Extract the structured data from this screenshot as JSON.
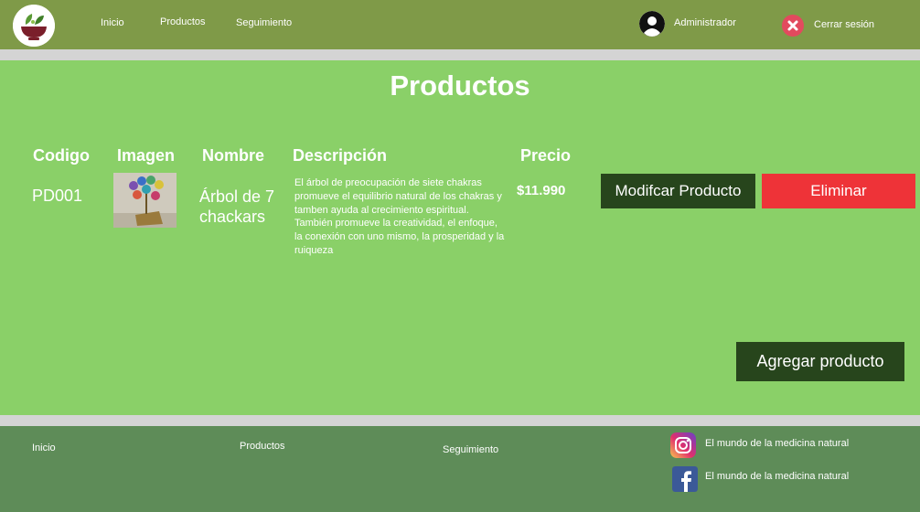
{
  "header": {
    "nav": [
      {
        "label": "Inicio"
      },
      {
        "label": "Productos"
      },
      {
        "label": "Seguimiento"
      }
    ],
    "user_label": "Administrador",
    "logout_label": "Cerrar sesión"
  },
  "main": {
    "title": "Productos",
    "columns": [
      "Codigo",
      "Imagen",
      "Nombre",
      "Descripción",
      "Precio"
    ],
    "rows": [
      {
        "code": "PD001",
        "name": "Árbol de 7 chackars",
        "description": "El árbol de preocupación de siete chakras promueve el equilibrio natural de los chakras y tamben ayuda al crecimiento espiritual.\nTambién promueve la creatividad, el enfoque, la conexión con uno mismo, la prosperidad y la ruiqueza",
        "price": "$11.990",
        "edit_label": "Modifcar Producto",
        "delete_label": "Eliminar"
      }
    ],
    "add_label": "Agregar producto"
  },
  "footer": {
    "links": [
      {
        "label": "Inicio"
      },
      {
        "label": "Productos"
      },
      {
        "label": "Seguimiento"
      }
    ],
    "social": [
      {
        "icon": "instagram-icon",
        "label": "El mundo de la medicina natural"
      },
      {
        "icon": "facebook-icon",
        "label": "El mundo de la medicina natural"
      }
    ]
  },
  "colors": {
    "header_bg": "#7f9a48",
    "main_bg": "#8ad068",
    "footer_bg": "#5e8c58",
    "dark_button": "#27451c",
    "danger_button": "#ee3338"
  }
}
